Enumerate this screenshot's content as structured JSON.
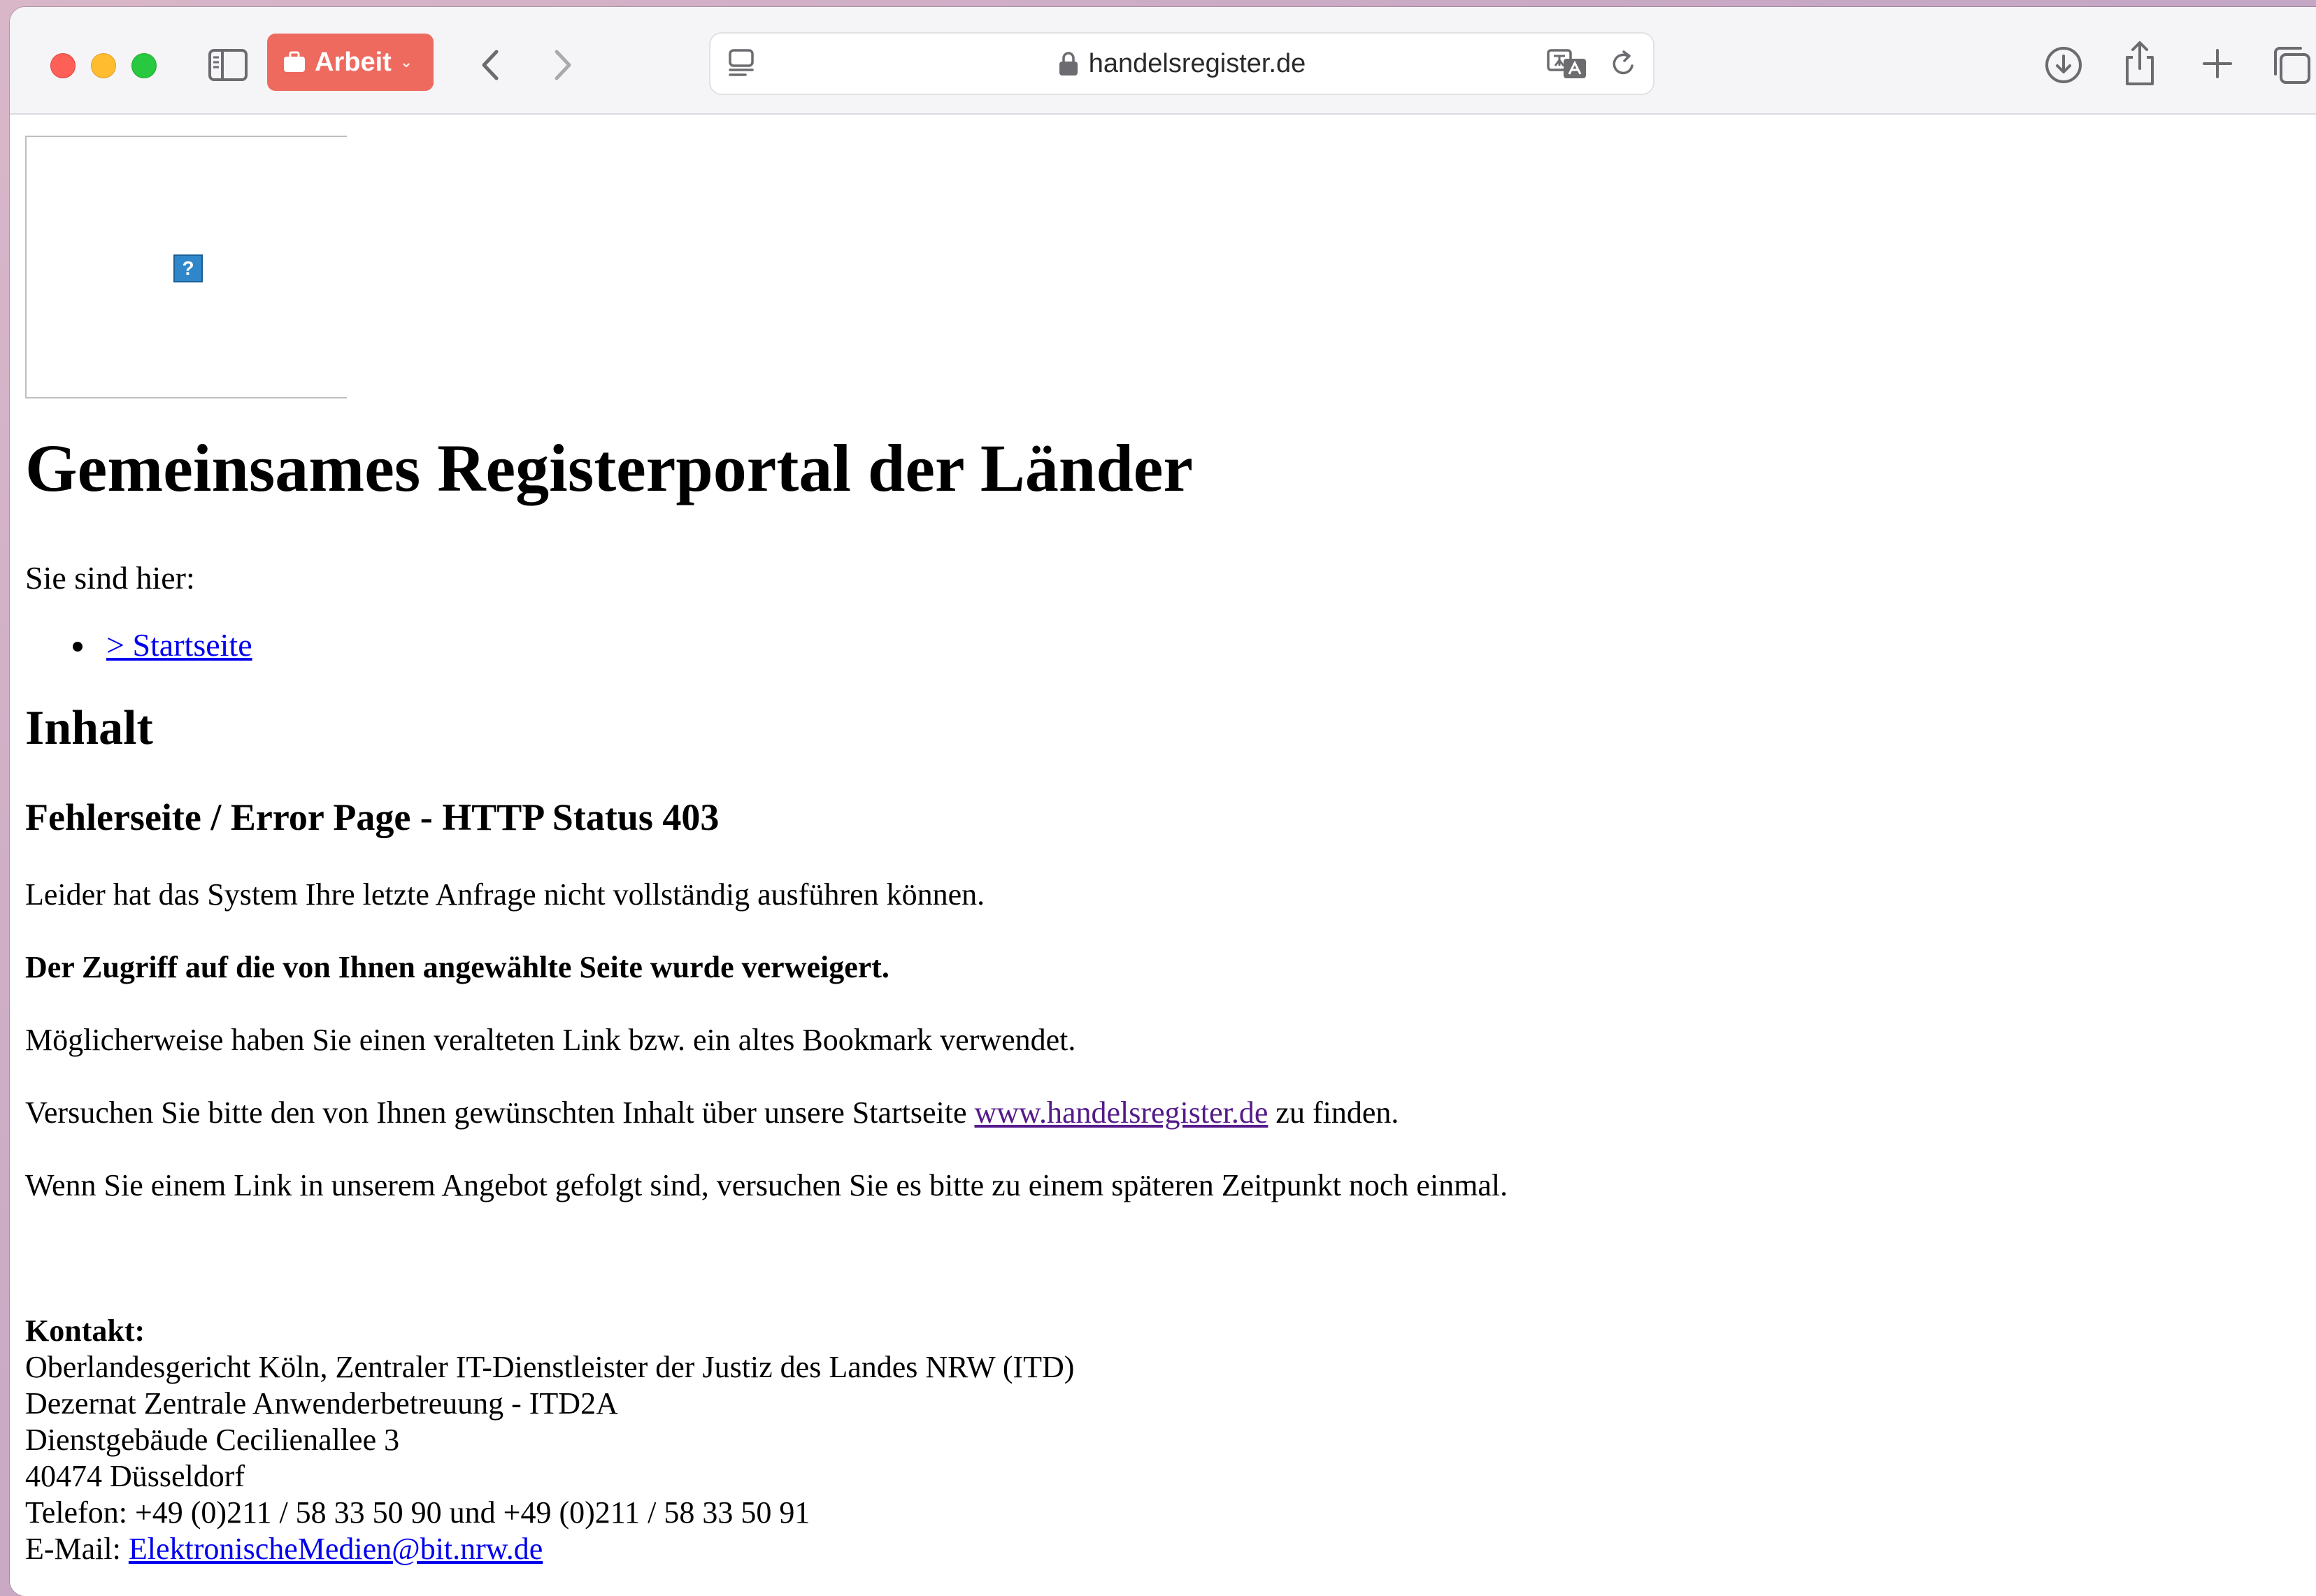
{
  "browser": {
    "tab_group_label": "Arbeit",
    "url": "handelsregister.de"
  },
  "page": {
    "title": "Gemeinsames Registerportal der Länder",
    "breadcrumb_label": "Sie sind hier:",
    "breadcrumb_items": [
      {
        "label": "> Startseite"
      }
    ],
    "section_heading": "Inhalt",
    "error_heading": "Fehlerseite / Error Page - HTTP Status 403",
    "paragraphs": {
      "p1": "Leider hat das System Ihre letzte Anfrage nicht vollständig ausführen können.",
      "p2": "Der Zugriff auf die von Ihnen angewählte Seite wurde verweigert.",
      "p3": "Möglicherweise haben Sie einen veralteten Link bzw. ein altes Bookmark verwendet.",
      "p4_before": "Versuchen Sie bitte den von Ihnen gewünschten Inhalt über unsere Startseite ",
      "p4_link": "www.handelsregister.de",
      "p4_after": " zu finden.",
      "p5": "Wenn Sie einem Link in unserem Angebot gefolgt sind, versuchen Sie es bitte zu einem späteren Zeitpunkt noch einmal."
    },
    "contact": {
      "heading": "Kontakt:",
      "line1": "Oberlandesgericht Köln, Zentraler IT-Dienstleister der Justiz des Landes NRW (ITD)",
      "line2": "Dezernat Zentrale Anwenderbetreuung - ITD2A",
      "line3": "Dienstgebäude Cecilienallee 3",
      "line4": "40474 Düsseldorf",
      "line5": "Telefon: +49 (0)211 / 58 33 50 90 und +49 (0)211 / 58 33 50 91",
      "email_label": "E-Mail: ",
      "email": "ElektronischeMedien@bit.nrw.de"
    },
    "broken_image_glyph": "?"
  },
  "colors": {
    "link": "#0000ee",
    "visited_link": "#551a8b",
    "tab_group": "#ee6a5f"
  }
}
